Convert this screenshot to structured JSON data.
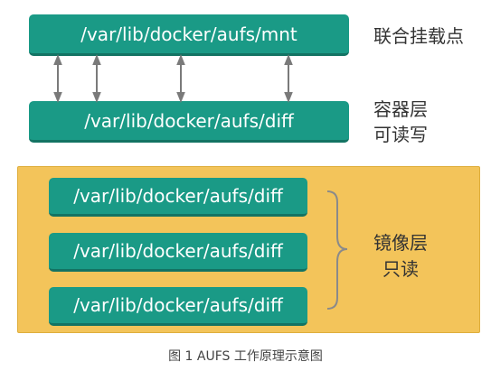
{
  "top_box": "/var/lib/docker/aufs/mnt",
  "top_label": "联合挂载点",
  "container_box": "/var/lib/docker/aufs/diff",
  "container_label_1": "容器层",
  "container_label_2": "可读写",
  "image_layers": [
    "/var/lib/docker/aufs/diff",
    "/var/lib/docker/aufs/diff",
    "/var/lib/docker/aufs/diff"
  ],
  "image_label_1": "镜像层",
  "image_label_2": "只读",
  "caption": "图 1 AUFS 工作原理示意图",
  "colors": {
    "box": "#1a9a86",
    "panel": "#f3c45a",
    "arrow": "#7a7a7a"
  }
}
